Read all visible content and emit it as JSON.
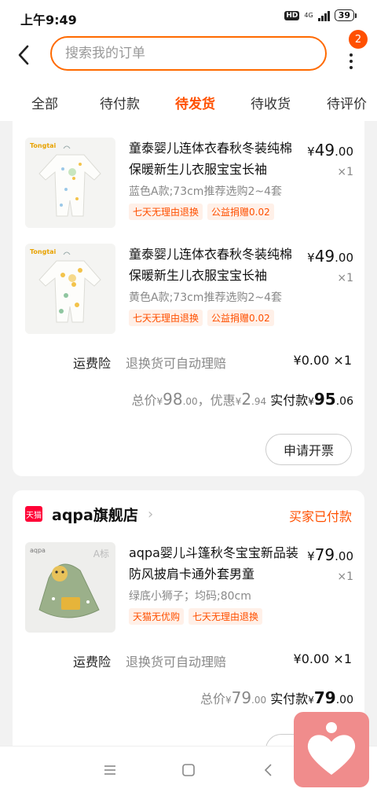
{
  "status_bar": {
    "time": "上午9:49",
    "hd": "HD",
    "network": "4G",
    "battery": "39"
  },
  "header": {
    "search_placeholder": "搜索我的订单",
    "badge_count": "2"
  },
  "tabs": [
    {
      "label": "全部"
    },
    {
      "label": "待付款"
    },
    {
      "label": "待发货",
      "active": true
    },
    {
      "label": "待收货"
    },
    {
      "label": "待评价"
    }
  ],
  "order1": {
    "items": [
      {
        "brand": "Tongtai",
        "title": "童泰婴儿连体衣春秋冬装纯棉保暖新生儿衣服宝宝长袖",
        "price_int": "49",
        "price_dec": ".00",
        "qty": "×1",
        "spec": "蓝色A款;73cm推荐选购2~4套",
        "tags": [
          "七天无理由退换",
          "公益捐赠0.02"
        ]
      },
      {
        "brand": "Tongtai",
        "title": "童泰婴儿连体衣春秋冬装纯棉保暖新生儿衣服宝宝长袖",
        "price_int": "49",
        "price_dec": ".00",
        "qty": "×1",
        "spec": "黄色A款;73cm推荐选购2~4套",
        "tags": [
          "七天无理由退换",
          "公益捐赠0.02"
        ]
      }
    ],
    "insurance": {
      "label": "运费险",
      "desc": "退换货可自动理赔",
      "price": "¥0.00 ×1"
    },
    "total": {
      "total_label": "总价",
      "total_int": "98",
      "total_dec": ".00",
      "discount_label": "，优惠",
      "discount_int": "2",
      "discount_dec": ".94",
      "paid_label": "实付款",
      "paid_int": "95",
      "paid_dec": ".06"
    },
    "invoice_button": "申请开票"
  },
  "order2": {
    "shop_logo": "天猫",
    "shop_name": "aqpa旗舰店",
    "status": "买家已付款",
    "items": [
      {
        "brand": "aqpa",
        "img_label": "A标",
        "title": "aqpa婴儿斗篷秋冬宝宝新品装防风披肩卡通外套男童",
        "price_int": "79",
        "price_dec": ".00",
        "qty": "×1",
        "spec": "绿底小狮子；均码;80cm",
        "tags": [
          "天猫无优购",
          "七天无理由退换"
        ]
      }
    ],
    "insurance": {
      "label": "运费险",
      "desc": "退换货可自动理赔",
      "price": "¥0.00 ×1"
    },
    "total": {
      "total_label": "总价",
      "total_int": "79",
      "total_dec": ".00",
      "paid_label": "实付款",
      "paid_int": "79",
      "paid_dec": ".00"
    }
  },
  "yen_symbol": "¥",
  "colors": {
    "accent": "#ff5000",
    "search_border": "#ff6a00",
    "tmall_red": "#ff0036",
    "float_bg": "#f08c8c"
  },
  "icons": [
    "back-arrow-icon",
    "more-dots-icon",
    "menu-icon",
    "home-square-icon",
    "back-triangle-icon",
    "heart-icon"
  ]
}
